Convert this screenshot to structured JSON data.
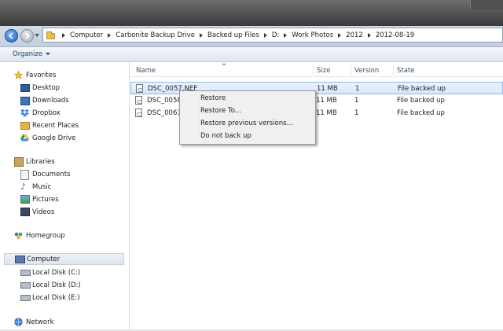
{
  "breadcrumbs": [
    "Computer",
    "Carbonite Backup Drive",
    "Backed up Files",
    "D:",
    "Work Photos",
    "2012",
    "2012-08-19"
  ],
  "toolbar": {
    "organize_label": "Organize"
  },
  "nav": {
    "favorites": {
      "label": "Favorites",
      "items": [
        "Desktop",
        "Downloads",
        "Dropbox",
        "Recent Places",
        "Google Drive"
      ]
    },
    "libraries": {
      "label": "Libraries",
      "items": [
        "Documents",
        "Music",
        "Pictures",
        "Videos"
      ]
    },
    "homegroup": {
      "label": "Homegroup"
    },
    "computer": {
      "label": "Computer",
      "items": [
        "Local Disk (C:)",
        "Local Disk (D:)",
        "Local Disk (E:)"
      ]
    },
    "network": {
      "label": "Network"
    }
  },
  "columns": {
    "name": "Name",
    "size": "Size",
    "version": "Version",
    "state": "State"
  },
  "files": [
    {
      "name": "DSC_0057.NEF",
      "size": "11 MB",
      "version": "1",
      "state": "File backed up"
    },
    {
      "name": "DSC_0058.",
      "size": "11 MB",
      "version": "1",
      "state": "File backed up"
    },
    {
      "name": "DSC_0063.",
      "size": "11 MB",
      "version": "1",
      "state": "File backed up"
    }
  ],
  "context_menu": [
    "Restore",
    "Restore To...",
    "Restore previous versions...",
    "Do not back up"
  ],
  "colors": {
    "accent": "#1c5fc4",
    "selection": "#d6e8fb",
    "selection_border": "#8fb8e6",
    "folder": "#e9c24e"
  }
}
